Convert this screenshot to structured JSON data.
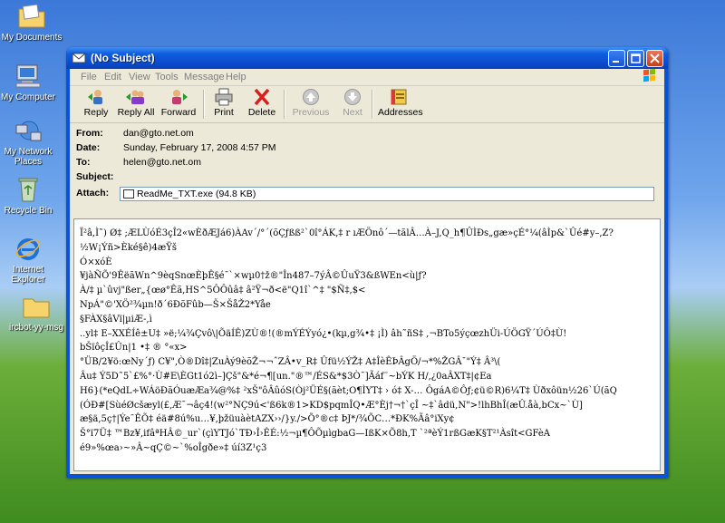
{
  "desktop_icons": [
    {
      "label": "My Documents"
    },
    {
      "label": "My Computer"
    },
    {
      "label": "My Network Places"
    },
    {
      "label": "Recycle Bin"
    },
    {
      "label": "Internet Explorer"
    },
    {
      "label": "ircbot-yy-msg"
    }
  ],
  "window": {
    "title": "(No Subject)"
  },
  "menu": [
    "File",
    "Edit",
    "View",
    "Tools",
    "Message",
    "Help"
  ],
  "toolbar": {
    "reply": "Reply",
    "reply_all": "Reply All",
    "forward": "Forward",
    "print": "Print",
    "delete": "Delete",
    "previous": "Previous",
    "next": "Next",
    "addresses": "Addresses"
  },
  "headers": {
    "from_label": "From:",
    "from_value": "dan@gto.net.om",
    "date_label": "Date:",
    "date_value": "Sunday, February 17, 2008 4:57 PM",
    "to_label": "To:",
    "to_value": "helen@gto.net.om",
    "subject_label": "Subject:",
    "subject_value": "",
    "attach_label": "Attach:",
    "attach_value": "ReadMe_TXT.exe (94.8 KB)"
  },
  "body_lines": [
    "Ï²â,Ì˜) Ø‡  ;ÆLÙóÉ3çÎ2«wÈðÆJá6)ÀAv´/°´(õÇƒßß²`0î°ÁK,‡  r ıÆÖnô´—tãlÂ…À–J,Q_h¶ÛÌÐs„gæ»çÉ°¼(âÌp&`Ûé#y–,Z?",
    "½W¡Ýñ>Èké§ê)4æŸš",
    "Ó×xóÈ",
    "¥jàÑÕ'9ÊëãWn^9èqSnœÈþÊ§é¯`×wµ0†ž®\"În487–7ýÂ©ÛuŸ3&ßWEn<ù|ƒ?",
    "À/‡ µ`ûvj\"ßer„{œø°Êã,HS^5ÔÔûâ‡  â²Ÿ¬ð<ë\"Q1î`^‡  \"$Ñ‡,$<",
    "NpÁ\"©'XÖ²¾µn!ð´6ÐõFûb—Š×ŠåŽ2*Yåe",
    "§FÀX§âVï|µiÆ-,ì",
    "..yl‡  E–XXÉÍê±U‡  »ë;¼¾Çvô\\|ÕäÍÊ)ZÙ®!(®mÝÉÝyó¿•(kµ,g¾•‡ ¡Ì) âh˜ñS‡  ,¬BTo5ýçœzhÜi-ÚÖGŸ´ÚÔ‡Ù!",
    "bŠïôçÎ£Ûn|1  •‡  ® °«x>",
    "°ÜB/2¥ö:œNy´ƒ) C¥\",Ò®Dî‡|ZuÀý9èõŽ¬¬ˆZÂ•v_R‡  Ûfü½ÝŽ‡  A‡ÎèÊÞÂgÖ/¬*%ŽGÂ¯\"Ý‡  Â³\\(",
    "Âu‡  Ý5D˜5`£%°·Ù#E\\ÈGt1ó2ì–]Çš\"&*é¬¶[un.\"®™/ÉS&*$3Ò¯]Ãáf¨~bÝK H/,¿0aÂXT‡|¢Ea",
    "H6}(*eQdL÷WÁöÐãÓuæÆa¾@%‡  ²xŠ\"ôÂûóS(Òj²ÜÉ§(ãèt;O¶ÌYT‡  ›  ó‡ X-… ÔgáA©Ôƒ;¢ü©R)6¼T‡  Ùðxôün½26`Ú(ãQ",
    "(ÓÐ#[SùéØcšæyl(£,Æ¯¬âç4!(w²°NÇ9ú<'ß6k®1>KD$pqmÎQ•Æ°Èj†¬†`çÎ ~‡`âdü,N\">!lhBhÎ(æÛ.åà,bCx~`Ù]",
    "æ§ä,5ç†|Ýe¯ÊÕ‡  éä#8ú%u…¥,þžüuàètAZX››/}y./>Õ°®c‡  ÞJ*/¾ÕC…*ÐK%Ãâ°iXy¢",
    "Š°ï7Ü‡  ™Bz¥,ifâªHÂ©_ur`(çìYTJó`TÐ›Î›ÊÉ:½¬µ¶ÔÕµìgbaG—IßK×Õ8h,T `²ªèÝ1rßGæK§T²¹Àsît<GFèA",
    "é9»%œa›~»Â~qÇ©~`%oÎgðe»‡  úí3Z¹ç3"
  ]
}
